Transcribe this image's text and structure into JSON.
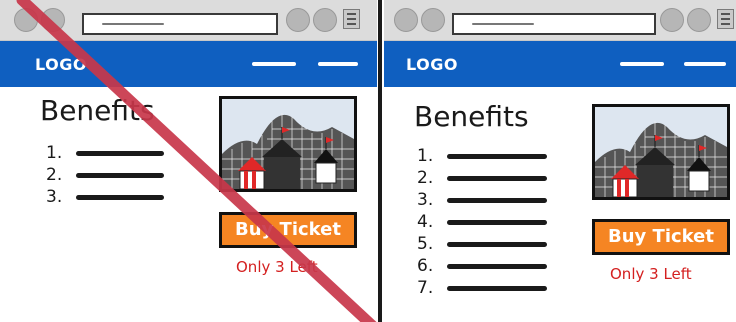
{
  "variants": {
    "left": {
      "logo": "LOGO",
      "heading": "Benefits",
      "benefit_numbers": [
        "1.",
        "2.",
        "3."
      ],
      "buy_button_label": "Buy Ticket",
      "stock_notice": "Only 3 Left",
      "crossed_out": true
    },
    "right": {
      "logo": "LOGO",
      "heading": "Benefits",
      "benefit_numbers": [
        "1.",
        "2.",
        "3.",
        "4.",
        "5.",
        "6.",
        "7."
      ],
      "buy_button_label": "Buy Ticket",
      "stock_notice": "Only 3 Left",
      "crossed_out": false
    }
  },
  "colors": {
    "nav_background": "#0f5fc0",
    "button_background": "#f58523",
    "stock_text": "#d42020",
    "cross_out_line": "#c8374a"
  },
  "icons": [
    "browser-menu-icon",
    "circus-tent-rollercoaster-image"
  ]
}
